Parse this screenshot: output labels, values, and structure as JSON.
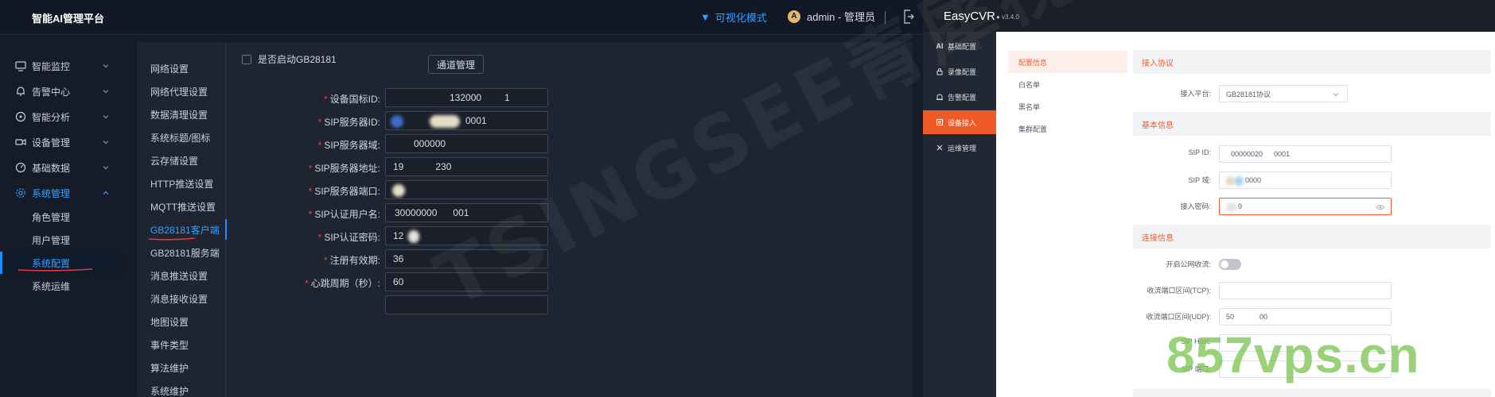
{
  "left_app": {
    "logo": "智能AI管理平台",
    "viz_mode": "可视化模式",
    "user_initial": "A",
    "user": "admin - 管理员",
    "nav": [
      {
        "label": "智能监控",
        "icon": "monitor-icon"
      },
      {
        "label": "告警中心",
        "icon": "bell-icon"
      },
      {
        "label": "智能分析",
        "icon": "compass-icon"
      },
      {
        "label": "设备管理",
        "icon": "camera-icon"
      },
      {
        "label": "基础数据",
        "icon": "gauge-icon"
      },
      {
        "label": "系统管理",
        "icon": "gear-icon"
      }
    ],
    "sub_nav": [
      "角色管理",
      "用户管理",
      "系统配置",
      "系统运维"
    ],
    "settings_tabs": [
      "网络设置",
      "网络代理设置",
      "数据清理设置",
      "系统标题/图标",
      "云存储设置",
      "HTTP推送设置",
      "MQTT推送设置",
      "GB28181客户端",
      "GB28181服务端",
      "消息推送设置",
      "消息接收设置",
      "地图设置",
      "事件类型",
      "算法维护",
      "系统维护"
    ],
    "gb_enable_label": "是否启动GB28181",
    "channel_button": "通道管理",
    "form": [
      {
        "label": "设备国标ID:",
        "value": "132000",
        "value2": "1",
        "required": true
      },
      {
        "label": "SIP服务器ID:",
        "value": "0001",
        "required": true
      },
      {
        "label": "SIP服务器域:",
        "value": "000000",
        "required": true
      },
      {
        "label": "SIP服务器地址:",
        "value": "19",
        "value2": "230",
        "required": true
      },
      {
        "label": "SIP服务器端口:",
        "value": "",
        "required": true
      },
      {
        "label": "SIP认证用户名:",
        "value": "30000000",
        "value2": "001",
        "required": true
      },
      {
        "label": "SIP认证密码:",
        "value": "12",
        "required": true
      },
      {
        "label": "注册有效期:",
        "value": "36",
        "required": true
      },
      {
        "label": "心跳周期（秒）:",
        "value": "60",
        "required": true
      }
    ]
  },
  "right_app": {
    "title": "EasyCVR",
    "version": "v3.4.0",
    "side": [
      {
        "label": "基础配置",
        "icon": "AI"
      },
      {
        "label": "录像配置",
        "icon": "lock-icon"
      },
      {
        "label": "告警配置",
        "icon": "alarm-icon"
      },
      {
        "label": "设备接入",
        "icon": "device-icon"
      },
      {
        "label": "运维管理",
        "icon": "tools-icon"
      }
    ],
    "sub": [
      "配置信息",
      "白名单",
      "黑名单",
      "集群配置"
    ],
    "sections": {
      "access_protocol": "接入协议",
      "basic_info": "基本信息",
      "connection_info": "连接信息"
    },
    "platform_label": "接入平台:",
    "platform_value": "GB28181协议",
    "sip_id_label": "SIP ID:",
    "sip_id_value": "00000020",
    "sip_id_value2": "0001",
    "sip_domain_label": "SIP 域:",
    "sip_domain_value": "0000",
    "password_label": "接入密码:",
    "password_value": "9",
    "public_stream_label": "开启公网收流:",
    "tcp_range_label": "收流端口区间(TCP):",
    "udp_range_label": "收流端口区间(UDP):",
    "udp_range_value": "50",
    "udp_range_value2": "00",
    "sip_host_label": "SIP Host:",
    "sip_port_label": "SIP 端口:"
  },
  "watermarks": {
    "diagonal": "TSINGSEE青犀视频",
    "site": "857vps.cn"
  },
  "colors": {
    "left_accent": "#3aa0ff",
    "right_accent": "#f05a28",
    "required": "#e0454f"
  }
}
